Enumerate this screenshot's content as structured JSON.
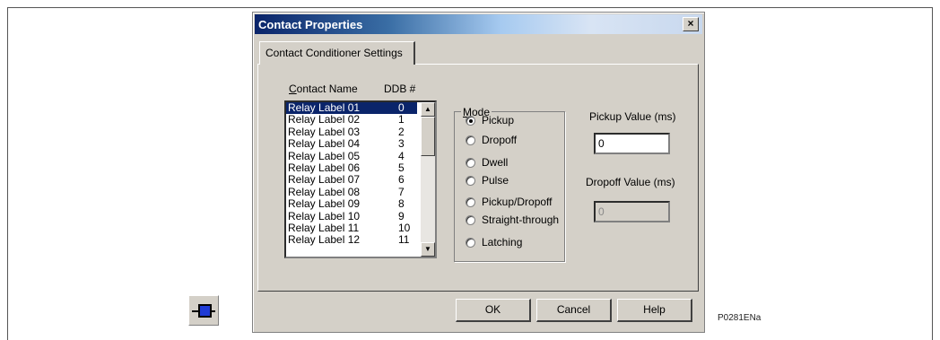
{
  "dialog": {
    "title": "Contact Properties",
    "close_glyph": "×"
  },
  "tab": {
    "label": "Contact Conditioner Settings"
  },
  "contacts": {
    "header_name": "Contact Name",
    "header_ddb": "DDB #",
    "rows": [
      {
        "name": "Relay Label 01",
        "ddb": "0"
      },
      {
        "name": "Relay Label 02",
        "ddb": "1"
      },
      {
        "name": "Relay Label 03",
        "ddb": "2"
      },
      {
        "name": "Relay Label 04",
        "ddb": "3"
      },
      {
        "name": "Relay Label 05",
        "ddb": "4"
      },
      {
        "name": "Relay Label 06",
        "ddb": "5"
      },
      {
        "name": "Relay Label 07",
        "ddb": "6"
      },
      {
        "name": "Relay Label 08",
        "ddb": "7"
      },
      {
        "name": "Relay Label 09",
        "ddb": "8"
      },
      {
        "name": "Relay Label 10",
        "ddb": "9"
      },
      {
        "name": "Relay Label 11",
        "ddb": "10"
      },
      {
        "name": "Relay Label 12",
        "ddb": "11"
      }
    ],
    "selected_index": 0
  },
  "mode": {
    "label": "Mode",
    "options": [
      "Pickup",
      "Dropoff",
      "Dwell",
      "Pulse",
      "Pickup/Dropoff",
      "Straight-through",
      "Latching"
    ],
    "selected_index": 0
  },
  "pickup": {
    "label": "Pickup Value (ms)",
    "value": "0"
  },
  "dropoff": {
    "label": "Dropoff Value (ms)",
    "value": "0"
  },
  "buttons": {
    "ok": "OK",
    "cancel": "Cancel",
    "help": "Help"
  },
  "figure_ref": "P0281ENa",
  "icons": {
    "scroll_up": "▲",
    "scroll_down": "▼"
  }
}
